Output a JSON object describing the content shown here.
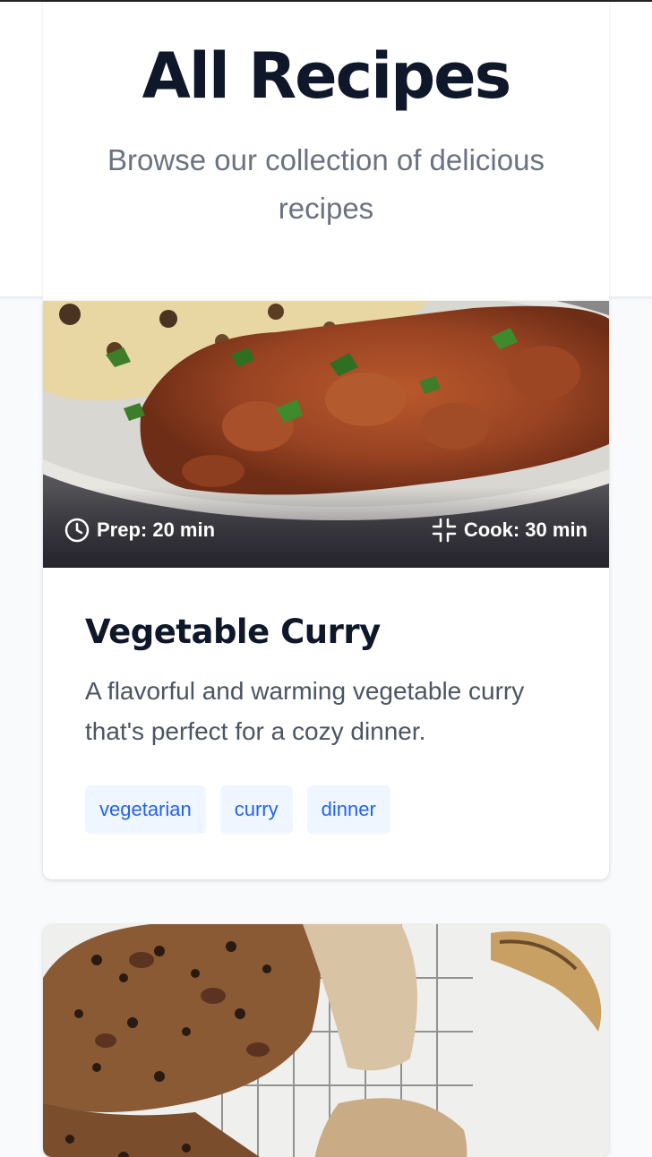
{
  "header": {
    "title": "All Recipes",
    "subtitle": "Browse our collection of delicious recipes"
  },
  "recipes": [
    {
      "prep_label": "Prep: 20 min",
      "cook_label": "Cook: 30 min",
      "title": "Vegetable Curry",
      "description": "A flavorful and warming vegetable curry that's perfect for a cozy dinner.",
      "tags": [
        "vegetarian",
        "curry",
        "dinner"
      ],
      "image_icon": "curry-photo"
    },
    {
      "image_icon": "banana-bread-photo"
    }
  ],
  "colors": {
    "title": "#0f172a",
    "tag_bg": "#eff6ff",
    "tag_text": "#2563eb",
    "page_bg": "#f8fafc"
  }
}
